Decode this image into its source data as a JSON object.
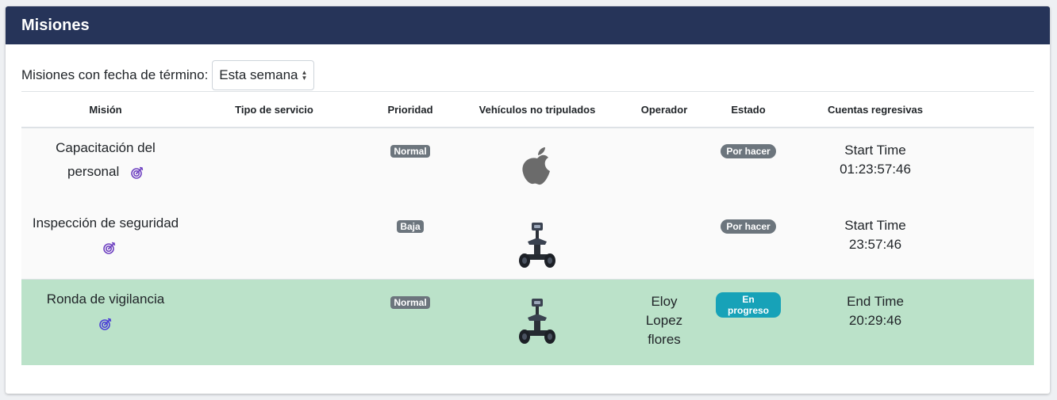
{
  "header": {
    "title": "Misiones"
  },
  "filter": {
    "label": "Misiones con fecha de término:",
    "selected": "Esta semana"
  },
  "columns": [
    "Misión",
    "Tipo de servicio",
    "Prioridad",
    "Vehículos no tripulados",
    "Operador",
    "Estado",
    "Cuentas regresivas"
  ],
  "rows": [
    {
      "mission": "Capacitación del personal",
      "service": "",
      "priority": "Normal",
      "vehicle": "apple-icon",
      "operator": "",
      "status": "Por hacer",
      "countdown_label": "Start Time",
      "countdown_value": "01:23:57:46"
    },
    {
      "mission": "Inspección de seguridad",
      "service": "",
      "priority": "Baja",
      "vehicle": "robot-icon",
      "operator": "",
      "status": "Por hacer",
      "countdown_label": "Start Time",
      "countdown_value": "23:57:46"
    },
    {
      "mission": "Ronda de vigilancia",
      "service": "",
      "priority": "Normal",
      "vehicle": "robot-icon",
      "operator": "Eloy Lopez flores",
      "status": "En progreso",
      "countdown_label": "End Time",
      "countdown_value": "20:29:46"
    }
  ],
  "colors": {
    "header_bg": "#263459",
    "active_row_bg": "#bbe2c9",
    "badge_secondary": "#6c757d",
    "badge_info": "#17a2b8",
    "target_icon": "#6f42c1"
  }
}
